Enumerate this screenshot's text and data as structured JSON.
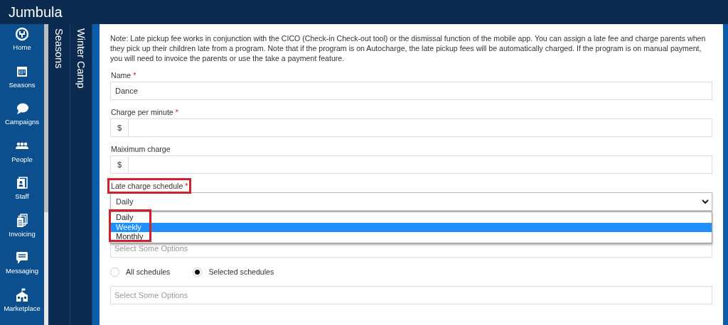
{
  "app": {
    "title": "Jumbula"
  },
  "nav": [
    {
      "label": "Home"
    },
    {
      "label": "Seasons"
    },
    {
      "label": "Campaigns"
    },
    {
      "label": "People"
    },
    {
      "label": "Staff"
    },
    {
      "label": "Invoicing"
    },
    {
      "label": "Messaging"
    },
    {
      "label": "Marketplace"
    }
  ],
  "panels": [
    {
      "label": "Seasons"
    },
    {
      "label": "Winter Camp"
    }
  ],
  "form": {
    "note": "Note: Late pickup fee works in conjunction with the CICO (Check-in Check-out tool) or the dismissal function of the mobile app. You can assign a late fee and charge parents when they pick up their children late from a program. Note that if the program is on Autocharge, the late pickup fees will be automatically charged. If the program is on manual payment, you will need to invoice the parents or use the take a payment feature.",
    "fields": [
      {
        "kind": "text",
        "label": "Name",
        "required_mark": "*",
        "value": "Dance"
      },
      {
        "kind": "money",
        "label": "Charge per minute",
        "required_mark": "*",
        "prefix": "$"
      },
      {
        "kind": "money",
        "label": "Maiximum charge",
        "prefix": "$"
      },
      {
        "kind": "select",
        "label": "Late charge schedule",
        "required_mark": "*",
        "highlighted": true,
        "value": "Daily",
        "expanded": true,
        "options_highlighted": true,
        "options": [
          {
            "label": "Daily",
            "highlighted": false
          },
          {
            "label": "Weekly",
            "highlighted": true
          },
          {
            "label": "Monthly",
            "highlighted": false
          }
        ]
      },
      {
        "kind": "multiselect",
        "placeholder": "Select Some Options"
      },
      {
        "kind": "radios",
        "options": [
          {
            "label": "All schedules",
            "selected": false
          },
          {
            "label": "Selected schedules",
            "selected": true
          }
        ]
      },
      {
        "kind": "multiselect",
        "placeholder": "Select Some Options"
      }
    ]
  }
}
